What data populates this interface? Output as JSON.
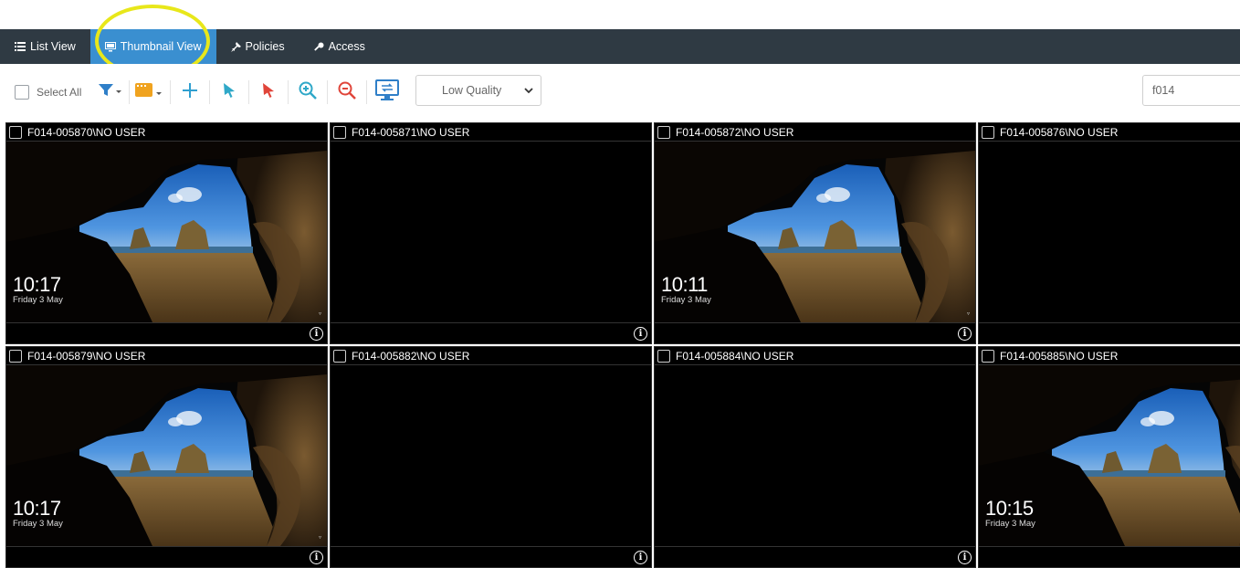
{
  "tabs": [
    {
      "label": "List View",
      "icon": "list-icon",
      "active": false
    },
    {
      "label": "Thumbnail View",
      "icon": "monitor-icon",
      "active": true
    },
    {
      "label": "Policies",
      "icon": "pin-icon",
      "active": false
    },
    {
      "label": "Access",
      "icon": "key-icon",
      "active": false
    }
  ],
  "toolbar": {
    "select_all_label": "Select All",
    "quality_value": "Low Quality",
    "search_value": "f014",
    "colors": {
      "filter": "#2f7fc8",
      "group": "#f0a31f",
      "add": "#2f9fd0",
      "pointer_blue": "#2fa8c8",
      "pointer_red": "#e0453a",
      "zoom_in": "#2fa8c8",
      "zoom_out": "#e0453a",
      "monitor": "#2f7fc8"
    }
  },
  "highlight_color": "#e8e71a",
  "tiles": [
    {
      "name": "F014-005870\\NO USER",
      "has_screen": true,
      "time": "10:17",
      "date": "Friday 3 May"
    },
    {
      "name": "F014-005871\\NO USER",
      "has_screen": false,
      "time": "",
      "date": ""
    },
    {
      "name": "F014-005872\\NO USER",
      "has_screen": true,
      "time": "10:11",
      "date": "Friday 3 May"
    },
    {
      "name": "F014-005876\\NO USER",
      "has_screen": false,
      "time": "",
      "date": ""
    },
    {
      "name": "F014-005879\\NO USER",
      "has_screen": true,
      "time": "10:17",
      "date": "Friday 3 May"
    },
    {
      "name": "F014-005882\\NO USER",
      "has_screen": false,
      "time": "",
      "date": ""
    },
    {
      "name": "F014-005884\\NO USER",
      "has_screen": false,
      "time": "",
      "date": ""
    },
    {
      "name": "F014-005885\\NO USER",
      "has_screen": true,
      "time": "10:15",
      "date": "Friday 3 May"
    }
  ]
}
